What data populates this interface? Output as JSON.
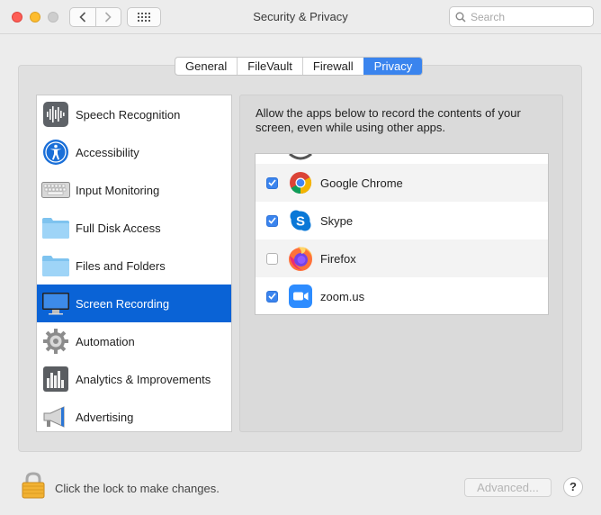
{
  "window": {
    "title": "Security & Privacy"
  },
  "search": {
    "placeholder": "Search",
    "value": ""
  },
  "tabs": [
    {
      "label": "General",
      "active": false
    },
    {
      "label": "FileVault",
      "active": false
    },
    {
      "label": "Firewall",
      "active": false
    },
    {
      "label": "Privacy",
      "active": true
    }
  ],
  "sidebar": {
    "items": [
      {
        "label": "Speech Recognition",
        "icon": "waveform-icon",
        "selected": false
      },
      {
        "label": "Accessibility",
        "icon": "accessibility-icon",
        "selected": false
      },
      {
        "label": "Input Monitoring",
        "icon": "keyboard-icon",
        "selected": false
      },
      {
        "label": "Full Disk Access",
        "icon": "folder-icon",
        "selected": false
      },
      {
        "label": "Files and Folders",
        "icon": "folder-icon",
        "selected": false
      },
      {
        "label": "Screen Recording",
        "icon": "display-icon",
        "selected": true
      },
      {
        "label": "Automation",
        "icon": "gear-icon",
        "selected": false
      },
      {
        "label": "Analytics & Improvements",
        "icon": "bar-chart-icon",
        "selected": false
      },
      {
        "label": "Advertising",
        "icon": "megaphone-icon",
        "selected": false
      }
    ]
  },
  "main": {
    "description": "Allow the apps below to record the contents of your screen, even while using other apps.",
    "apps": [
      {
        "name": "Google Chrome",
        "checked": true,
        "icon": "chrome-icon"
      },
      {
        "name": "Skype",
        "checked": true,
        "icon": "skype-icon"
      },
      {
        "name": "Firefox",
        "checked": false,
        "icon": "firefox-icon"
      },
      {
        "name": "zoom.us",
        "checked": true,
        "icon": "zoom-icon"
      }
    ]
  },
  "footer": {
    "lock_text": "Click the lock to make changes.",
    "advanced_label": "Advanced...",
    "help_label": "?"
  },
  "colors": {
    "accent": "#3a84ee",
    "selection": "#0a63d6"
  }
}
